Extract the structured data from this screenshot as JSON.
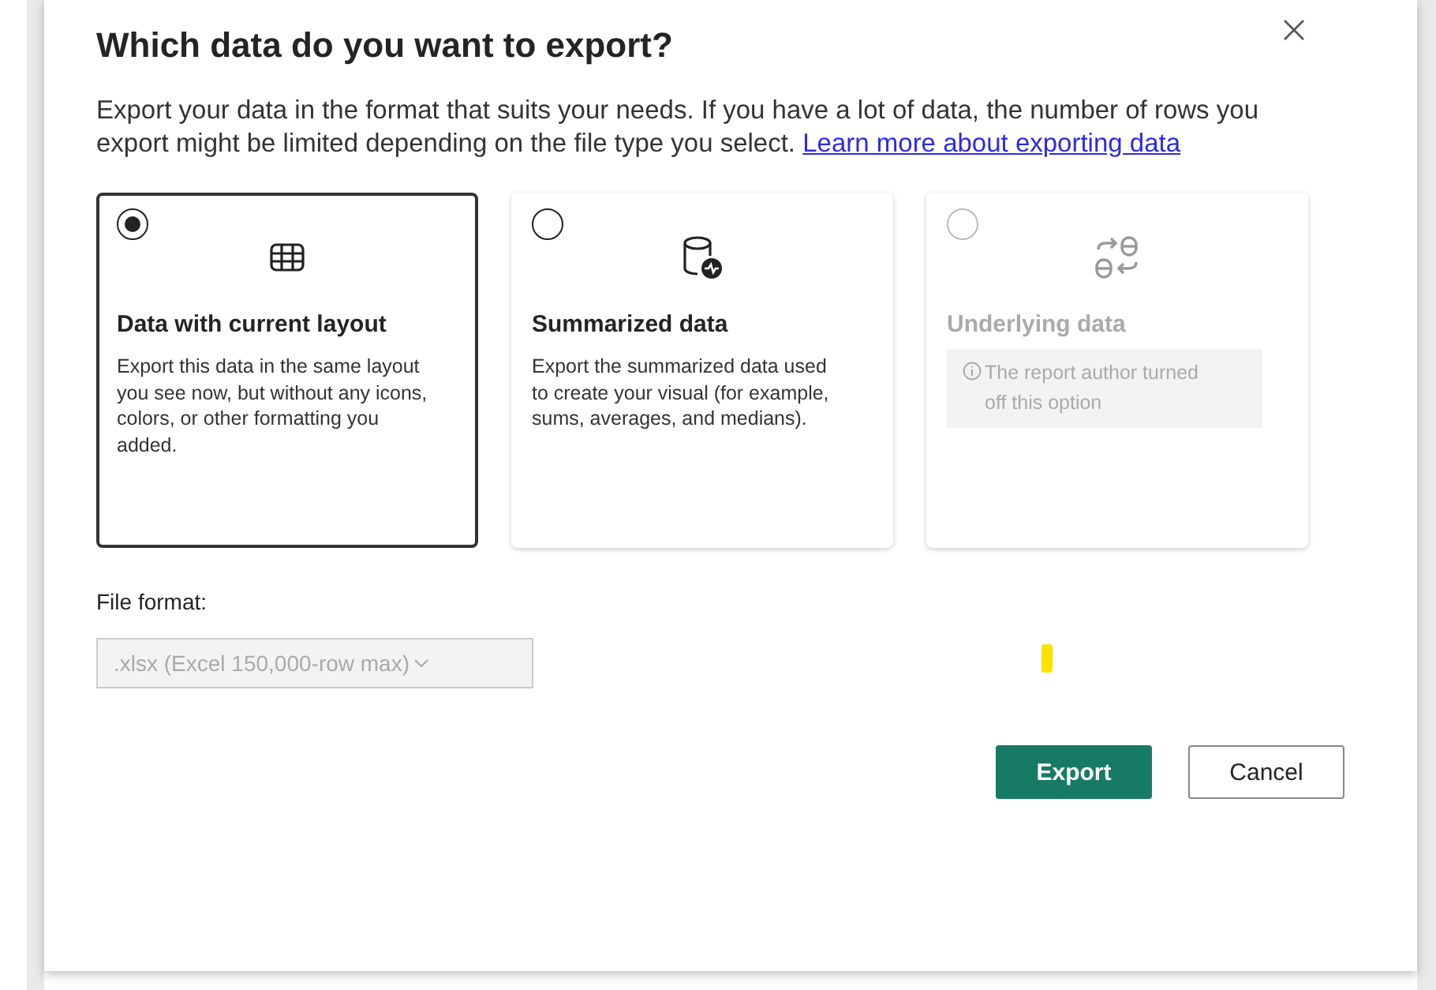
{
  "dialog": {
    "title": "Which data do you want to export?",
    "description": "Export your data in the format that suits your needs. If you have a lot of data, the number of rows you export might be limited depending on the file type you select.",
    "link": "Learn more about exporting data",
    "options": [
      {
        "kind": "table",
        "title": "Data with current layout",
        "description": "Export this data in the same layout you see now, but without any icons, colors, or other formatting you added.",
        "selected": true,
        "disabled": false
      },
      {
        "kind": "summary",
        "title": "Summarized data",
        "description": "Export the summarized data used to create your visual (for example, sums, averages, and medians).",
        "selected": false,
        "disabled": false
      },
      {
        "kind": "underlying",
        "title": "Underlying data",
        "notice": "The report author turned off this option",
        "selected": false,
        "disabled": true
      }
    ],
    "file_format": {
      "label": "File format:",
      "value": ".xlsx (Excel 150,000-row max)",
      "disabled": true
    },
    "buttons": [
      {
        "label": "Export",
        "primary": true
      },
      {
        "label": "Cancel",
        "primary": false
      }
    ]
  }
}
